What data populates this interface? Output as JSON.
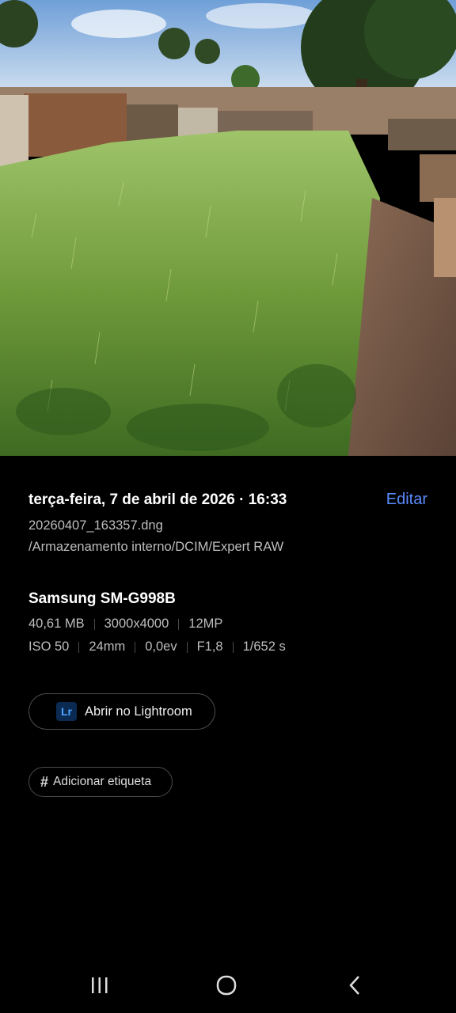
{
  "photo": {
    "description_icon": "photo-cemetery-grass"
  },
  "details": {
    "datetime": "terça-feira, 7 de abril de 2026 · 16:33",
    "edit_label": "Editar",
    "filename": "20260407_163357.dng",
    "path": "/Armazenamento interno/DCIM/Expert RAW",
    "device": "Samsung SM-G998B",
    "specs_row1": [
      "40,61 MB",
      "3000x4000",
      "12MP"
    ],
    "specs_row2": [
      "ISO 50",
      "24mm",
      "0,0ev",
      "F1,8",
      "1/652 s"
    ]
  },
  "actions": {
    "lightroom_logo": "Lr",
    "lightroom_label": "Abrir no Lightroom",
    "tag_label": "Adicionar etiqueta"
  },
  "colors": {
    "accent": "#5b8cff",
    "background": "#000000"
  },
  "navbar": {
    "icons": [
      "recent-apps-icon",
      "home-icon",
      "back-icon"
    ]
  }
}
